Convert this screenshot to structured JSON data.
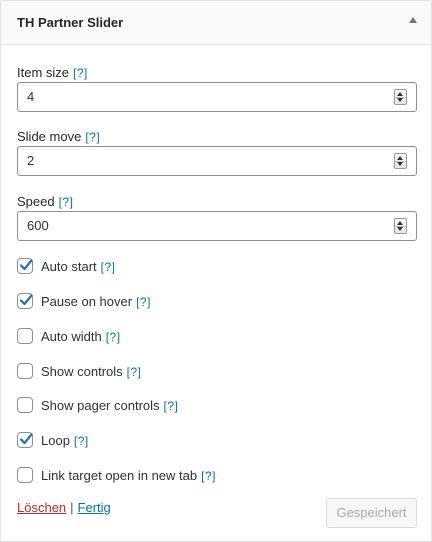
{
  "widget": {
    "title": "TH Partner Slider"
  },
  "help_text": "[?]",
  "fields": [
    {
      "label": "Item size",
      "value": "4"
    },
    {
      "label": "Slide move",
      "value": "2"
    },
    {
      "label": "Speed",
      "value": "600"
    }
  ],
  "checkboxes": [
    {
      "label": "Auto start",
      "checked": true
    },
    {
      "label": "Pause on hover",
      "checked": true
    },
    {
      "label": "Auto width",
      "checked": false
    },
    {
      "label": "Show controls",
      "checked": false
    },
    {
      "label": "Show pager controls",
      "checked": false
    },
    {
      "label": "Loop",
      "checked": true
    },
    {
      "label": "Link target open in new tab",
      "checked": false
    }
  ],
  "footer": {
    "delete_label": "Löschen",
    "separator": "|",
    "done_label": "Fertig",
    "saved_label": "Gespeichert"
  },
  "colors": {
    "accent": "#0073aa",
    "delete": "#b32d2e"
  }
}
